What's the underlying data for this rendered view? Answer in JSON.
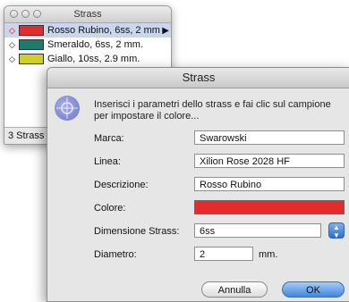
{
  "panel": {
    "title": "Strass",
    "items": [
      {
        "label": "Rosso Rubino, 6ss, 2 mm",
        "color": "#e02c2c"
      },
      {
        "label": "Smeraldo, 6ss, 2 mm.",
        "color": "#1f7a6e"
      },
      {
        "label": "Giallo, 10ss, 2.9 mm.",
        "color": "#cfcf2a"
      }
    ],
    "status": "3 Strass"
  },
  "dialog": {
    "title": "Strass",
    "description": "Inserisci i parametri dello strass e fai clic sul campione per impostare il colore...",
    "fields": {
      "marca": {
        "label": "Marca:",
        "value": "Swarowski"
      },
      "linea": {
        "label": "Linea:",
        "value": "Xilion Rose 2028 HF"
      },
      "descrizione": {
        "label": "Descrizione:",
        "value": "Rosso Rubino"
      },
      "colore": {
        "label": "Colore:",
        "color": "#e62b2f"
      },
      "dimensione": {
        "label": "Dimensione Strass:",
        "value": "6ss"
      },
      "diametro": {
        "label": "Diametro:",
        "value": "2",
        "unit": "mm."
      }
    },
    "buttons": {
      "cancel": "Annulla",
      "ok": "OK"
    }
  }
}
